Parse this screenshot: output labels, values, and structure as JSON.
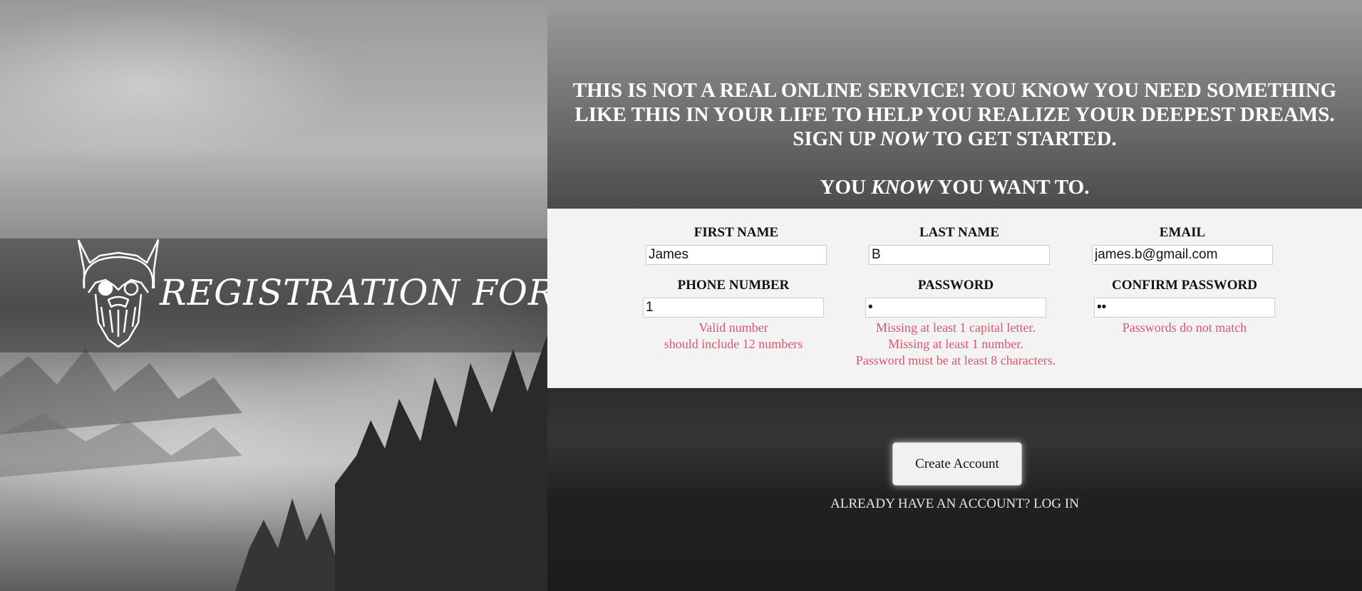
{
  "hero": {
    "title": "REGISTRATION FORM",
    "logo_icon": "bearded-helmet-logo-icon"
  },
  "headline": {
    "line1": "THIS IS NOT A REAL ONLINE SERVICE! YOU KNOW YOU NEED SOMETHING",
    "line2": "LIKE THIS IN YOUR LIFE TO HELP YOU REALIZE YOUR DEEPEST DREAMS.",
    "line3_pre": "SIGN UP ",
    "line3_em": "NOW",
    "line3_post": " TO GET STARTED.",
    "line4_pre": "YOU ",
    "line4_em": "KNOW",
    "line4_post": " YOU WANT TO."
  },
  "form": {
    "first_name": {
      "label": "FIRST NAME",
      "value": "James"
    },
    "last_name": {
      "label": "LAST NAME",
      "value": "B"
    },
    "email": {
      "label": "EMAIL",
      "value": "james.b@gmail.com"
    },
    "phone": {
      "label": "PHONE NUMBER",
      "value": "1",
      "errors": [
        "Valid number",
        "should include 12 numbers"
      ]
    },
    "password": {
      "label": "PASSWORD",
      "value": "a",
      "errors": [
        "Missing at least 1 capital letter.",
        "Missing at least 1 number.",
        "Password must be at least 8 characters."
      ]
    },
    "confirm_password": {
      "label": "CONFIRM PASSWORD",
      "value": "ab",
      "errors": [
        "Passwords do not match"
      ]
    }
  },
  "actions": {
    "create_account": "Create Account",
    "login_link": "ALREADY HAVE AN ACCOUNT? LOG IN"
  },
  "colors": {
    "error": "#d9566b",
    "form_bg": "#f3f3f3",
    "headline_text": "#ffffff"
  }
}
